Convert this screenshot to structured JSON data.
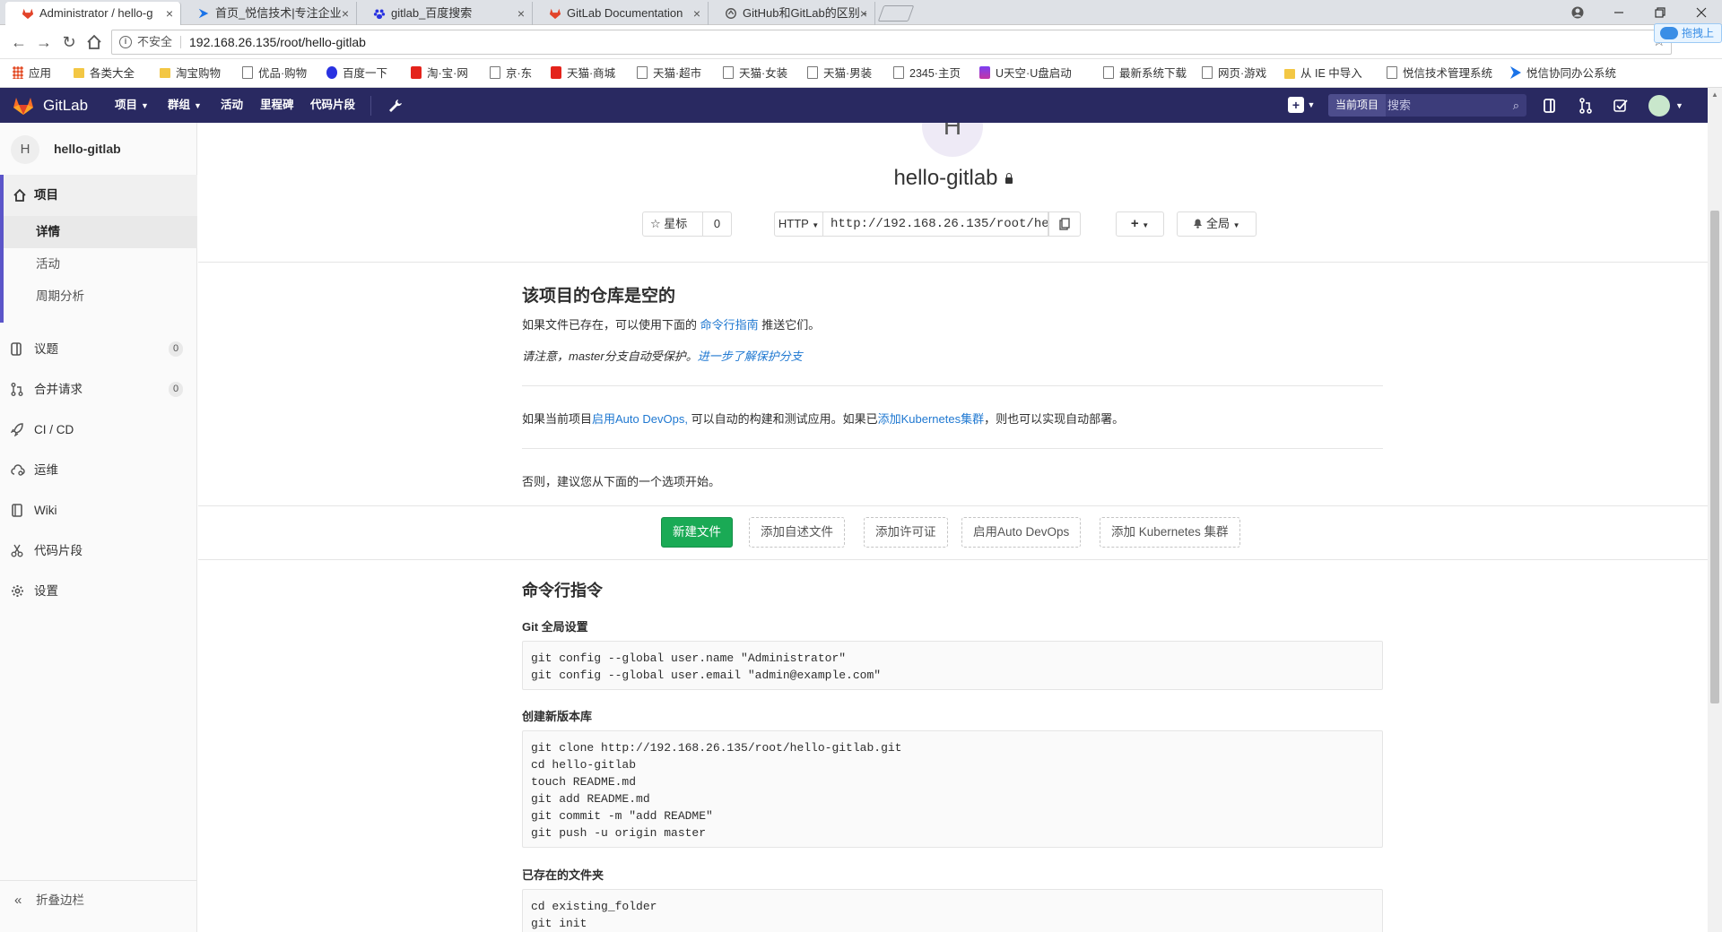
{
  "browser": {
    "tabs": [
      {
        "title": "Administrator / hello-g",
        "active": true
      },
      {
        "title": "首页_悦信技术|专注企业",
        "active": false
      },
      {
        "title": "gitlab_百度搜索",
        "active": false
      },
      {
        "title": "GitLab Documentation",
        "active": false
      },
      {
        "title": "GitHub和GitLab的区别 -",
        "active": false
      }
    ],
    "close_glyph": "×",
    "insecure_label": "不安全",
    "url": "192.168.26.135/root/hello-gitlab",
    "cloud_badge": "拖拽上",
    "bookmarks": [
      {
        "label": "应用",
        "icon": "grid"
      },
      {
        "label": "各类大全",
        "icon": "folder"
      },
      {
        "label": "淘宝购物",
        "icon": "folder"
      },
      {
        "label": "优品·购物",
        "icon": "page"
      },
      {
        "label": "百度一下",
        "icon": "baidu"
      },
      {
        "label": "淘·宝·网",
        "icon": "red"
      },
      {
        "label": "京·东",
        "icon": "page"
      },
      {
        "label": "天猫·商城",
        "icon": "red"
      },
      {
        "label": "天猫·超市",
        "icon": "page"
      },
      {
        "label": "天猫·女装",
        "icon": "page"
      },
      {
        "label": "天猫·男装",
        "icon": "page"
      },
      {
        "label": "2345·主页",
        "icon": "page"
      },
      {
        "label": "U天空·U盘启动",
        "icon": "u"
      },
      {
        "label": "最新系统下载",
        "icon": "page"
      },
      {
        "label": "网页·游戏",
        "icon": "page"
      },
      {
        "label": "从 IE 中导入",
        "icon": "ie"
      },
      {
        "label": "悦信技术管理系统",
        "icon": "page"
      },
      {
        "label": "悦信协同办公系统",
        "icon": "blue"
      }
    ]
  },
  "gitlab_header": {
    "brand": "GitLab",
    "nav": [
      {
        "label": "项目",
        "dropdown": true
      },
      {
        "label": "群组",
        "dropdown": true
      },
      {
        "label": "活动",
        "dropdown": false
      },
      {
        "label": "里程碑",
        "dropdown": false
      },
      {
        "label": "代码片段",
        "dropdown": false
      }
    ],
    "search_scope": "当前项目",
    "search_placeholder": "搜索",
    "colors": {
      "header_bg": "#292961",
      "accent": "#5b55c9",
      "primary_button": "#1aaa55",
      "link": "#1f78d1"
    }
  },
  "sidebar": {
    "project_initial": "H",
    "project_name": "hello-gitlab",
    "project_section": "项目",
    "project_subitems": [
      {
        "label": "详情",
        "active": true
      },
      {
        "label": "活动",
        "active": false
      },
      {
        "label": "周期分析",
        "active": false
      }
    ],
    "items": [
      {
        "label": "议题",
        "count": "0",
        "icon": "issues-icon"
      },
      {
        "label": "合并请求",
        "count": "0",
        "icon": "merge-request-icon"
      },
      {
        "label": "CI / CD",
        "count": "",
        "icon": "rocket-icon"
      },
      {
        "label": "运维",
        "count": "",
        "icon": "cloud-gear-icon"
      },
      {
        "label": "Wiki",
        "count": "",
        "icon": "book-icon"
      },
      {
        "label": "代码片段",
        "count": "",
        "icon": "scissors-icon"
      },
      {
        "label": "设置",
        "count": "",
        "icon": "gear-icon"
      }
    ],
    "collapse_label": "折叠边栏"
  },
  "main": {
    "avatar_initial": "H",
    "title": "hello-gitlab",
    "star_label": "星标",
    "star_count": "0",
    "protocol": "HTTP",
    "clone_url": "http://192.168.26.135/root/hello-gitlab.git",
    "notification_label": "全局",
    "empty_title": "该项目的仓库是空的",
    "empty_text_prefix": "如果文件已存在，可以使用下面的 ",
    "empty_text_link": "命令行指南",
    "empty_text_suffix": " 推送它们。",
    "protect_note": "请注意，master分支自动受保护。",
    "protect_link": "进一步了解保护分支",
    "devops_prefix": "如果当前项目",
    "devops_link": "启用Auto DevOps,",
    "devops_middle": " 可以自动的构建和测试应用。如果已",
    "k8s_link": "添加Kubernetes集群",
    "devops_suffix": "，则也可以实现自动部署。",
    "options_text": "否则，建议您从下面的一个选项开始。",
    "actions": [
      {
        "label": "新建文件",
        "primary": true
      },
      {
        "label": "添加自述文件",
        "primary": false
      },
      {
        "label": "添加许可证",
        "primary": false
      },
      {
        "label": "启用Auto DevOps",
        "primary": false
      },
      {
        "label": "添加 Kubernetes 集群",
        "primary": false
      }
    ],
    "cli_title": "命令行指令",
    "global_title": "Git 全局设置",
    "global_code": "git config --global user.name \"Administrator\"\ngit config --global user.email \"admin@example.com\"",
    "newrepo_title": "创建新版本库",
    "newrepo_code": "git clone http://192.168.26.135/root/hello-gitlab.git\ncd hello-gitlab\ntouch README.md\ngit add README.md\ngit commit -m \"add README\"\ngit push -u origin master",
    "existing_title": "已存在的文件夹",
    "existing_code": "cd existing_folder\ngit init"
  }
}
